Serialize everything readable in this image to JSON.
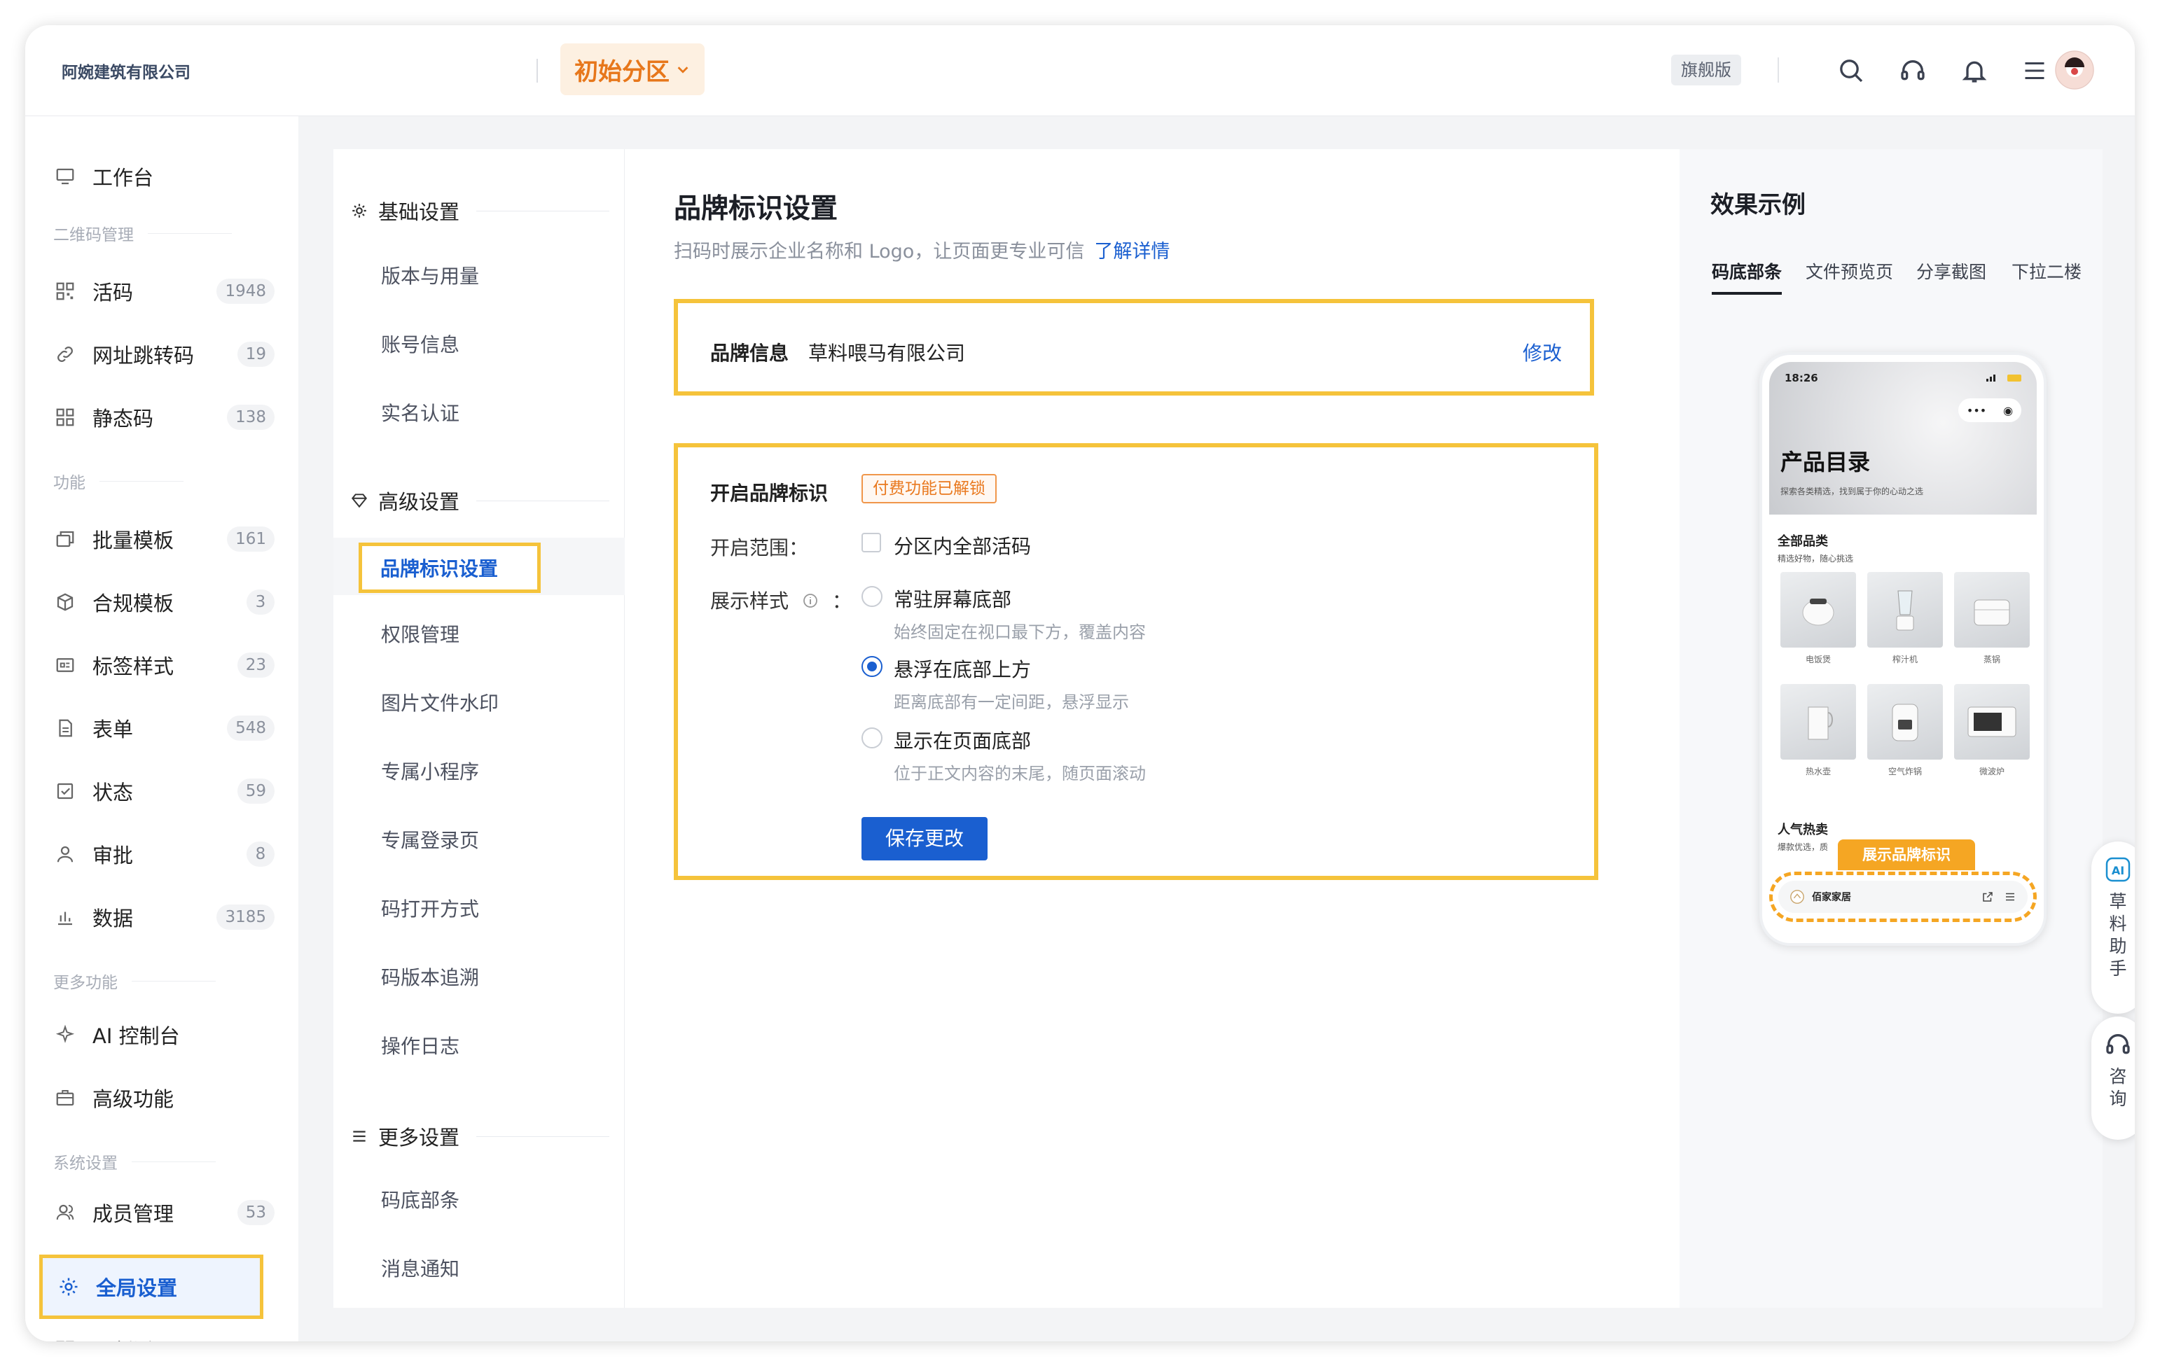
{
  "header": {
    "company": "阿婉建筑有限公司",
    "zone": "初始分区",
    "edition": "旗舰版",
    "icons": [
      "search-icon",
      "headset-icon",
      "bell-icon",
      "menu-icon"
    ]
  },
  "sidebar": {
    "workbench": "工作台",
    "sections": {
      "qr": "二维码管理",
      "func": "功能",
      "more": "更多功能",
      "system": "系统设置"
    },
    "items": [
      {
        "label": "活码",
        "count": "1948"
      },
      {
        "label": "网址跳转码",
        "count": "19"
      },
      {
        "label": "静态码",
        "count": "138"
      },
      {
        "label": "批量模板",
        "count": "161"
      },
      {
        "label": "合规模板",
        "count": "3"
      },
      {
        "label": "标签样式",
        "count": "23"
      },
      {
        "label": "表单",
        "count": "548"
      },
      {
        "label": "状态",
        "count": "59"
      },
      {
        "label": "审批",
        "count": "8"
      },
      {
        "label": "数据",
        "count": "3185"
      },
      {
        "label": "AI 控制台"
      },
      {
        "label": "高级功能"
      },
      {
        "label": "成员管理",
        "count": "53"
      },
      {
        "label": "全局设置"
      },
      {
        "label": "旧版活码"
      }
    ]
  },
  "submenu": {
    "basic": "基础设置",
    "basic_items": [
      "版本与用量",
      "账号信息",
      "实名认证"
    ],
    "advanced": "高级设置",
    "active": "品牌标识设置",
    "advanced_items": [
      "权限管理",
      "图片文件水印",
      "专属小程序",
      "专属登录页",
      "码打开方式",
      "码版本追溯",
      "操作日志"
    ],
    "more": "更多设置",
    "more_items": [
      "码底部条",
      "消息通知"
    ]
  },
  "main": {
    "title": "品牌标识设置",
    "desc": "扫码时展示企业名称和 Logo，让页面更专业可信",
    "learn_more": "了解详情",
    "brand_label": "品牌信息",
    "brand_value": "草料喂马有限公司",
    "edit": "修改",
    "enable_label": "开启品牌标识",
    "tag": "付费功能已解锁",
    "scope_label": "开启范围：",
    "scope_option": "分区内全部活码",
    "style_label": "展示样式",
    "style_colon": "：",
    "options": [
      {
        "title": "常驻屏幕底部",
        "desc": "始终固定在视口最下方，覆盖内容",
        "checked": false
      },
      {
        "title": "悬浮在底部上方",
        "desc": "距离底部有一定间距，悬浮显示",
        "checked": true
      },
      {
        "title": "显示在页面底部",
        "desc": "位于正文内容的末尾，随页面滚动",
        "checked": false
      }
    ],
    "save": "保存更改"
  },
  "preview": {
    "title": "效果示例",
    "tabs": [
      "码底部条",
      "文件预览页",
      "分享截图",
      "下拉二楼"
    ],
    "phone": {
      "time": "18:26",
      "hero_title": "产品目录",
      "hero_sub": "探索各类精选，找到属于你的心动之选",
      "cat_title": "全部品类",
      "cat_sub": "精选好物，随心挑选",
      "products": [
        "电饭煲",
        "榨汁机",
        "蒸锅",
        "热水壶",
        "空气炸锅",
        "微波炉"
      ],
      "hot_title": "人气热卖",
      "hot_sub": "爆款优选，质",
      "badge": "展示品牌标识",
      "bar_name": "佰家家居"
    }
  },
  "float": {
    "assistant": "草料助手",
    "consult": "咨询"
  },
  "colors": {
    "primary": "#1a5fd0",
    "accent_orange": "#e7771b",
    "highlight": "#f5c33b"
  }
}
